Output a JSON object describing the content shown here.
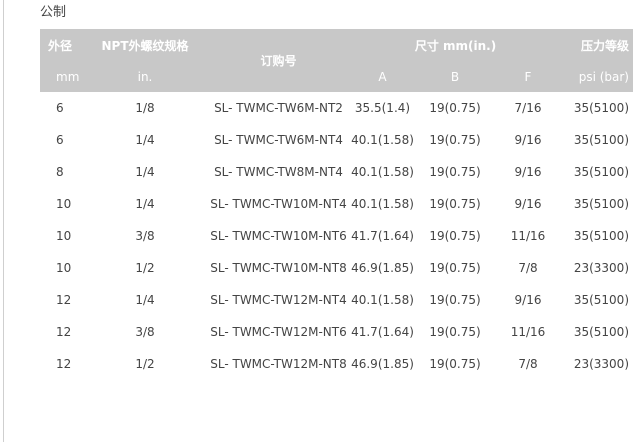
{
  "caption": "公制",
  "table": {
    "headers": {
      "od": "外径",
      "od_unit": "mm",
      "npt": "NPT外螺纹规格",
      "npt_unit": "in.",
      "order": "订购号",
      "size": "尺寸 mm(in.)",
      "size_a": "A",
      "size_b": "B",
      "size_f": "F",
      "pressure": "压力等级",
      "pressure_unit": "psi (bar)"
    },
    "rows": [
      {
        "od": "6",
        "npt": "1/8",
        "order": "SL- TWMC-TW6M-NT2",
        "a": "35.5(1.4)",
        "b": "19(0.75)",
        "f": "7/16",
        "pressure": "35(5100)"
      },
      {
        "od": "6",
        "npt": "1/4",
        "order": "SL- TWMC-TW6M-NT4",
        "a": "40.1(1.58)",
        "b": "19(0.75)",
        "f": "9/16",
        "pressure": "35(5100)"
      },
      {
        "od": "8",
        "npt": "1/4",
        "order": "SL- TWMC-TW8M-NT4",
        "a": "40.1(1.58)",
        "b": "19(0.75)",
        "f": "9/16",
        "pressure": "35(5100)"
      },
      {
        "od": "10",
        "npt": "1/4",
        "order": "SL- TWMC-TW10M-NT4",
        "a": "40.1(1.58)",
        "b": "19(0.75)",
        "f": "9/16",
        "pressure": "35(5100)"
      },
      {
        "od": "10",
        "npt": "3/8",
        "order": "SL- TWMC-TW10M-NT6",
        "a": "41.7(1.64)",
        "b": "19(0.75)",
        "f": "11/16",
        "pressure": "35(5100)"
      },
      {
        "od": "10",
        "npt": "1/2",
        "order": "SL- TWMC-TW10M-NT8",
        "a": "46.9(1.85)",
        "b": "19(0.75)",
        "f": "7/8",
        "pressure": "23(3300)"
      },
      {
        "od": "12",
        "npt": "1/4",
        "order": "SL- TWMC-TW12M-NT4",
        "a": "40.1(1.58)",
        "b": "19(0.75)",
        "f": "9/16",
        "pressure": "35(5100)"
      },
      {
        "od": "12",
        "npt": "3/8",
        "order": "SL- TWMC-TW12M-NT6",
        "a": "41.7(1.64)",
        "b": "19(0.75)",
        "f": "11/16",
        "pressure": "35(5100)"
      },
      {
        "od": "12",
        "npt": "1/2",
        "order": "SL- TWMC-TW12M-NT8",
        "a": "46.9(1.85)",
        "b": "19(0.75)",
        "f": "7/8",
        "pressure": "23(3300)"
      }
    ]
  }
}
